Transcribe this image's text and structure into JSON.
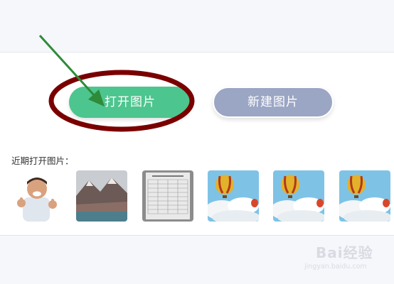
{
  "buttons": {
    "open_label": "打开图片",
    "new_label": "新建图片"
  },
  "recent": {
    "label": "近期打开图片：",
    "thumbnails": [
      {
        "subject": "man-thumbs-up"
      },
      {
        "subject": "mountain-lake"
      },
      {
        "subject": "document-table"
      },
      {
        "subject": "hot-air-balloon"
      },
      {
        "subject": "hot-air-balloon"
      },
      {
        "subject": "hot-air-balloon"
      }
    ]
  },
  "watermark": {
    "brand": "Bai经验",
    "url": "jingyan.baidu.com"
  },
  "colors": {
    "open_button": "#4dc58e",
    "new_button": "#9ba5c4",
    "ellipse": "#7a0000",
    "arrow": "#2e8b3a"
  }
}
